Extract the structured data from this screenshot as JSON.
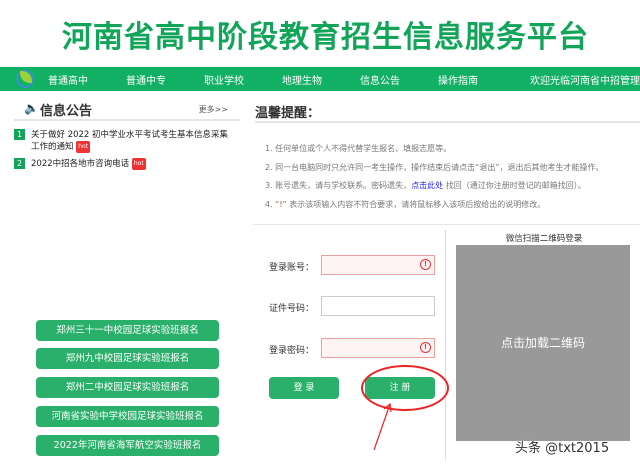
{
  "header": {
    "title": "河南省高中阶段教育招生信息服务平台"
  },
  "nav": {
    "items": [
      "普通高中",
      "普通中专",
      "职业学校",
      "地理生物",
      "信息公告",
      "操作指南"
    ],
    "welcome": "欢迎光临河南省中招管理"
  },
  "notices": {
    "title": "信息公告",
    "more": "更多>>",
    "hot": "hot",
    "items": [
      {
        "num": "1",
        "text": "关于做好 2022 初中学业水平考试考生基本信息采集工作的通知"
      },
      {
        "num": "2",
        "text": "2022中招各地市咨询电话"
      }
    ]
  },
  "tips": {
    "title": "温馨提醒：",
    "line1": "1. 任何单位或个人不得代替学生报名、填报志愿等。",
    "line2": "2. 同一台电脑同时只允许同一考生操作，操作结束后请点击“退出”，退出后其他考生才能操作。",
    "line3a": "3. 账号遗失，请与学校联系。密码遗失，",
    "line3link": "点击此处",
    "line3b": " 找回（通过你注册时登记的邮箱找回）。",
    "line4a": "4. “",
    "line4icon": "!",
    "line4b": "” 表示该项输入内容不符合要求，请将鼠标移入该项后按给出的说明修改。"
  },
  "login": {
    "account_label": "登录账号：",
    "id_label": "证件号码：",
    "password_label": "登录密码：",
    "login_button": "登 录",
    "register_button": "注 册",
    "error_icon": "!"
  },
  "qr": {
    "title": "微信扫描二维码登录",
    "placeholder": "点击加载二维码"
  },
  "links": [
    "郑州三十一中校园足球实验班报名",
    "郑州九中校园足球实验班报名",
    "郑州二中校园足球实验班报名",
    "河南省实验中学校园足球实验班报名",
    "2022年河南省海军航空实验班报名"
  ],
  "watermark": "头条 @txt2015"
}
